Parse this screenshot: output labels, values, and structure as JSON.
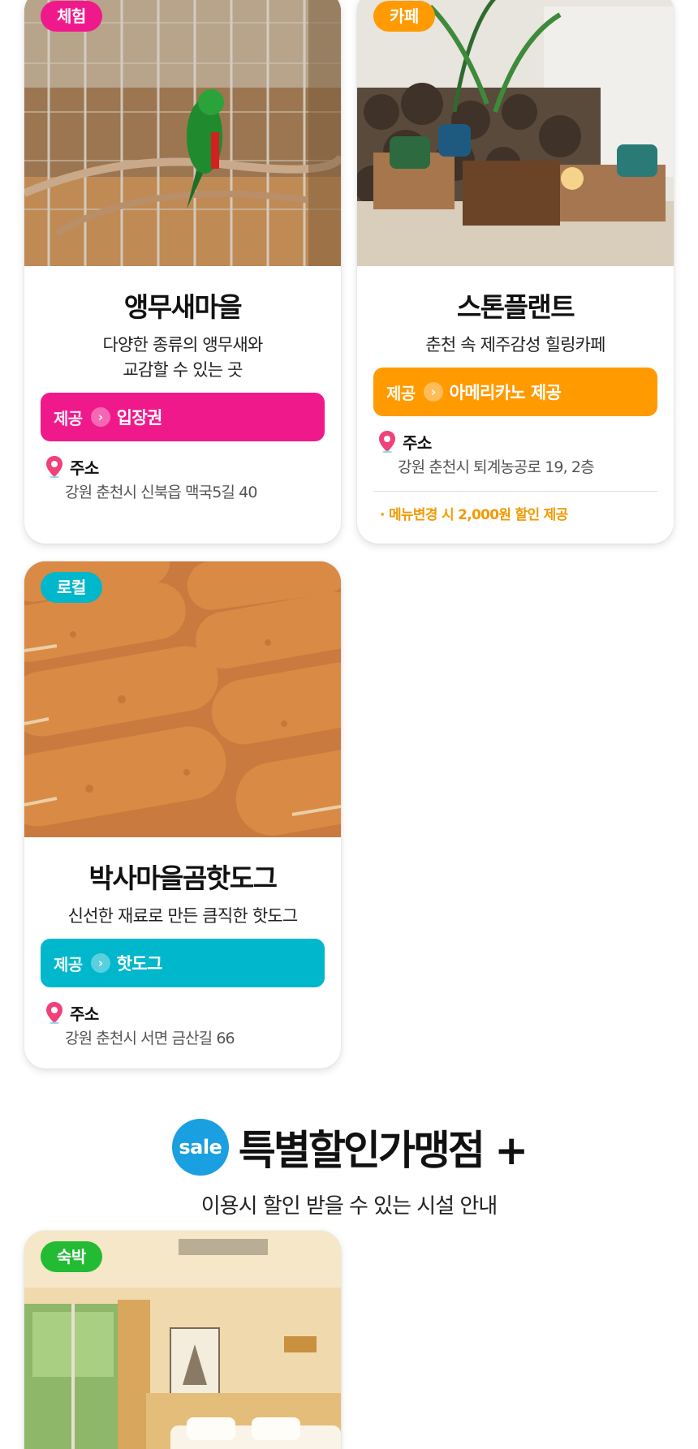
{
  "cards": [
    {
      "badge": "체험",
      "title": "앵무새마을",
      "desc": "다양한 종류의 앵무새와\n교감할 수 있는 곳",
      "offer_label": "제공",
      "offer_value": "입장권",
      "addr_label": "주소",
      "addr": "강원 춘천시 신북읍 맥국5길 40",
      "colors": {
        "accent": "#f0198c"
      }
    },
    {
      "badge": "카페",
      "title": "스톤플랜트",
      "desc": "춘천 속 제주감성 힐링카페",
      "offer_label": "제공",
      "offer_value": "아메리카노 제공",
      "addr_label": "주소",
      "addr": "강원 춘천시 퇴계농공로 19, 2층",
      "note": "· 메뉴변경 시 2,000원 할인 제공",
      "colors": {
        "accent": "#ff9a00"
      }
    },
    {
      "badge": "로컬",
      "title": "박사마을곰핫도그",
      "desc": "신선한 재료로 만든 큼직한 핫도그",
      "offer_label": "제공",
      "offer_value": "핫도그",
      "addr_label": "주소",
      "addr": "강원 춘천시 서면 금산길 66",
      "colors": {
        "accent": "#00b7cc"
      }
    },
    {
      "badge": "숙박",
      "colors": {
        "accent": "#22bb33"
      }
    }
  ],
  "section": {
    "sale_badge": "sale",
    "title": "특별할인가맹점 +",
    "subtitle": "이용시 할인 받을 수 있는 시설 안내",
    "colors": {
      "sale": "#1a9fe0"
    }
  },
  "icons": {
    "pin": "map-pin-icon",
    "arrow": "chevron-right-icon"
  }
}
